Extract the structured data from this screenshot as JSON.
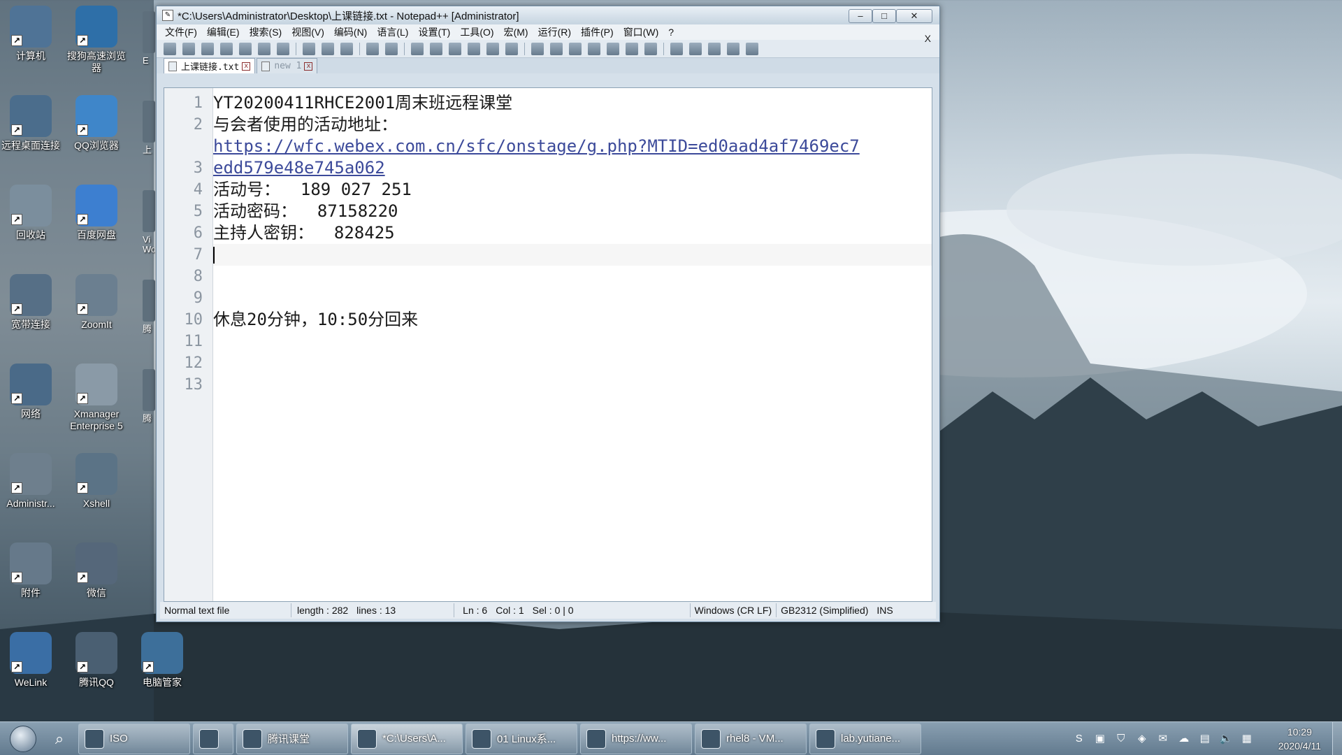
{
  "desktop_icons": [
    {
      "label": "计算机",
      "icon": "computer-icon",
      "color": "#4f7396"
    },
    {
      "label": "搜狗高速浏览器",
      "icon": "sogou-browser-icon",
      "color": "#2e6fa8"
    },
    {
      "label": "远程桌面连接",
      "icon": "remote-desktop-icon",
      "color": "#4b6d8c"
    },
    {
      "label": "QQ浏览器",
      "icon": "qq-browser-icon",
      "color": "#3f86c9"
    },
    {
      "label": "回收站",
      "icon": "recycle-bin-icon",
      "color": "#7b8e9d"
    },
    {
      "label": "百度网盘",
      "icon": "baidu-netdisk-icon",
      "color": "#3d7fd0"
    },
    {
      "label": "宽带连接",
      "icon": "broadband-icon",
      "color": "#566f86"
    },
    {
      "label": "ZoomIt",
      "icon": "zoomit-icon",
      "color": "#6b7f90"
    },
    {
      "label": "网络",
      "icon": "network-icon",
      "color": "#4a6a88"
    },
    {
      "label": "Xmanager Enterprise 5",
      "icon": "xmanager-icon",
      "color": "#8a9aa7"
    },
    {
      "label": "Administr...",
      "icon": "user-folder-icon",
      "color": "#6e7f8d"
    },
    {
      "label": "Xshell",
      "icon": "xshell-icon",
      "color": "#5b7386"
    },
    {
      "label": "附件",
      "icon": "accessories-icon",
      "color": "#66798a"
    },
    {
      "label": "微信",
      "icon": "wechat-icon",
      "color": "#55677a"
    },
    {
      "label": "WeLink",
      "icon": "welink-icon",
      "color": "#3a6ea5"
    },
    {
      "label": "腾讯QQ",
      "icon": "tencent-qq-icon",
      "color": "#4a5f72"
    },
    {
      "label": "电脑管家",
      "icon": "pc-manager-icon",
      "color": "#3d6f9a"
    }
  ],
  "edge_icon_labels": [
    "E",
    "上",
    "Vi Wo",
    "腾",
    "腾"
  ],
  "window": {
    "title": "*C:\\Users\\Administrator\\Desktop\\上课链接.txt - Notepad++ [Administrator]",
    "minimize": "–",
    "maximize": "□",
    "close": "✕",
    "menus": [
      "文件(F)",
      "编辑(E)",
      "搜索(S)",
      "视图(V)",
      "编码(N)",
      "语言(L)",
      "设置(T)",
      "工具(O)",
      "宏(M)",
      "运行(R)",
      "插件(P)",
      "窗口(W)",
      "?"
    ],
    "doc_close": "X",
    "tabs": [
      {
        "label": "上课链接.txt",
        "active": true,
        "close": "x"
      },
      {
        "label": "new 1",
        "active": false,
        "close": "x"
      }
    ]
  },
  "editor": {
    "line_numbers": [
      "1",
      "2",
      "",
      "3",
      "4",
      "5",
      "6",
      "7",
      "8",
      "9",
      "10",
      "11",
      "12",
      "13"
    ],
    "lines": [
      "YT20200411RHCE2001周末班远程课堂",
      "与会者使用的活动地址：",
      "https://wfc.webex.com.cn/sfc/onstage/g.php?MTID=ed0aad4af7469ec7",
      "edd579e48e745a062",
      "活动号：  189 027 251",
      "活动密码：  87158220",
      "主持人密钥：  828425",
      "",
      "",
      "",
      "休息20分钟，10:50分回来",
      "",
      "",
      ""
    ]
  },
  "status": {
    "type": "Normal text file",
    "length": "length : 282",
    "lines": "lines : 13",
    "ln": "Ln : 6",
    "col": "Col : 1",
    "sel": "Sel : 0 | 0",
    "eol": "Windows (CR LF)",
    "encoding": "GB2312 (Simplified)",
    "mode": "INS"
  },
  "taskbar": {
    "buttons": [
      {
        "label": "ISO",
        "icon": "folder-icon"
      },
      {
        "label": "",
        "icon": "sogou-icon"
      },
      {
        "label": "腾讯课堂",
        "icon": "tencent-classroom-icon"
      },
      {
        "label": "*C:\\Users\\A...",
        "icon": "notepadpp-icon",
        "active": true
      },
      {
        "label": "01 Linux系...",
        "icon": "wps-icon"
      },
      {
        "label": "https://ww...",
        "icon": "browser-icon"
      },
      {
        "label": "rhel8 - VM...",
        "icon": "vmware-icon"
      },
      {
        "label": "lab.yutiane...",
        "icon": "remote-desktop-icon"
      }
    ],
    "time": "10:29",
    "date": "2020/4/11"
  },
  "colors": {
    "accent": "#5f7890",
    "url": "#3c4a9a",
    "gutter_text": "#8b95a0"
  }
}
